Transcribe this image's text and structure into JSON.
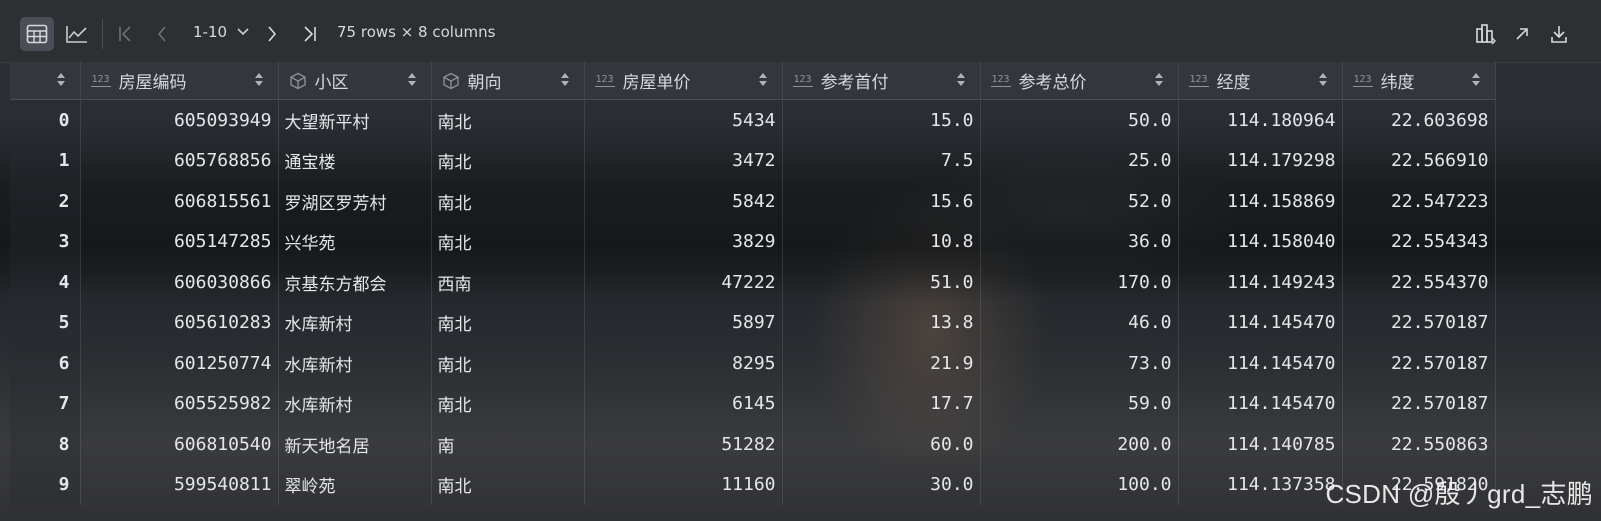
{
  "toolbar": {
    "icons": [
      "table-view-icon",
      "chart-view-icon",
      "first-page-icon",
      "prev-page-icon",
      "next-page-icon",
      "last-page-icon",
      "column-view-icon",
      "open-external-icon",
      "download-icon"
    ],
    "page_range": "1-10",
    "summary": "75 rows × 8 columns"
  },
  "table": {
    "index_header": "",
    "columns": [
      {
        "name": "房屋编码",
        "type": "123"
      },
      {
        "name": "小区",
        "type": "object"
      },
      {
        "name": "朝向",
        "type": "object"
      },
      {
        "name": "房屋单价",
        "type": "123"
      },
      {
        "name": "参考首付",
        "type": "123"
      },
      {
        "name": "参考总价",
        "type": "123"
      },
      {
        "name": "经度",
        "type": "123"
      },
      {
        "name": "纬度",
        "type": "123"
      }
    ],
    "rows": [
      {
        "idx": "0",
        "cells": [
          "605093949",
          "大望新平村",
          "南北",
          "5434",
          "15.0",
          "50.0",
          "114.180964",
          "22.603698"
        ]
      },
      {
        "idx": "1",
        "cells": [
          "605768856",
          "通宝楼",
          "南北",
          "3472",
          "7.5",
          "25.0",
          "114.179298",
          "22.566910"
        ]
      },
      {
        "idx": "2",
        "cells": [
          "606815561",
          "罗湖区罗芳村",
          "南北",
          "5842",
          "15.6",
          "52.0",
          "114.158869",
          "22.547223"
        ]
      },
      {
        "idx": "3",
        "cells": [
          "605147285",
          "兴华苑",
          "南北",
          "3829",
          "10.8",
          "36.0",
          "114.158040",
          "22.554343"
        ]
      },
      {
        "idx": "4",
        "cells": [
          "606030866",
          "京基东方都会",
          "西南",
          "47222",
          "51.0",
          "170.0",
          "114.149243",
          "22.554370"
        ]
      },
      {
        "idx": "5",
        "cells": [
          "605610283",
          "水库新村",
          "南北",
          "5897",
          "13.8",
          "46.0",
          "114.145470",
          "22.570187"
        ]
      },
      {
        "idx": "6",
        "cells": [
          "601250774",
          "水库新村",
          "南北",
          "8295",
          "21.9",
          "73.0",
          "114.145470",
          "22.570187"
        ]
      },
      {
        "idx": "7",
        "cells": [
          "605525982",
          "水库新村",
          "南北",
          "6145",
          "17.7",
          "59.0",
          "114.145470",
          "22.570187"
        ]
      },
      {
        "idx": "8",
        "cells": [
          "606810540",
          "新天地名居",
          "南",
          "51282",
          "60.0",
          "200.0",
          "114.140785",
          "22.550863"
        ]
      },
      {
        "idx": "9",
        "cells": [
          "599540811",
          "翠岭苑",
          "南北",
          "11160",
          "30.0",
          "100.0",
          "114.137358",
          "22.591820"
        ]
      }
    ]
  },
  "watermark": "CSDN @殷丿grd_志鹏"
}
